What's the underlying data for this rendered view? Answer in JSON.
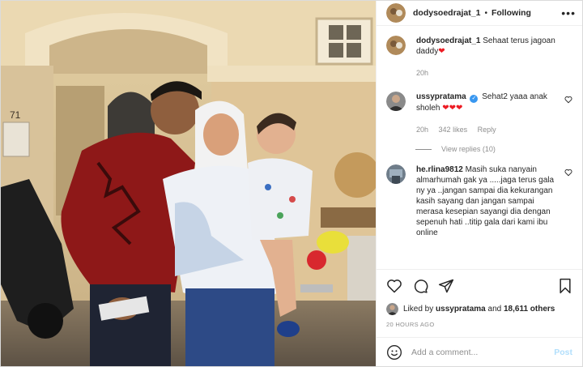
{
  "header": {
    "username": "dodysoedrajat_1",
    "separator": "•",
    "follow_status": "Following",
    "more": "•••"
  },
  "comments": [
    {
      "username": "dodysoedrajat_1",
      "text": "Sehaat terus jagoan daddy",
      "emoji": "❤",
      "time": "20h"
    },
    {
      "username": "ussypratama",
      "verified": true,
      "text": "Sehat2 yaaa anak sholeh",
      "emoji": "❤❤❤",
      "time": "20h",
      "likes": "342 likes",
      "reply": "Reply",
      "view_replies": "View replies (10)"
    },
    {
      "username": "he.rlina9812",
      "text": "Masih suka nanyain almarhumah gak ya .....jaga terus gala ny ya ..jangan sampai dia kekurangan kasih sayang dan jangan sampai merasa kesepian sayangi dia dengan sepenuh hati ..titip gala dari kami ibu online"
    }
  ],
  "likes": {
    "prefix": "Liked by",
    "liker": "ussypratama",
    "connector": "and",
    "others": "18,611 others"
  },
  "timestamp": "20 HOURS AGO",
  "add_comment": {
    "placeholder": "Add a comment...",
    "post_label": "Post"
  },
  "photo": {
    "house_number": "71"
  },
  "colors": {
    "accent": "#3897f0",
    "heart": "#ed1c24",
    "muted": "#8e8e8e",
    "post_disabled": "#b2dffc"
  }
}
